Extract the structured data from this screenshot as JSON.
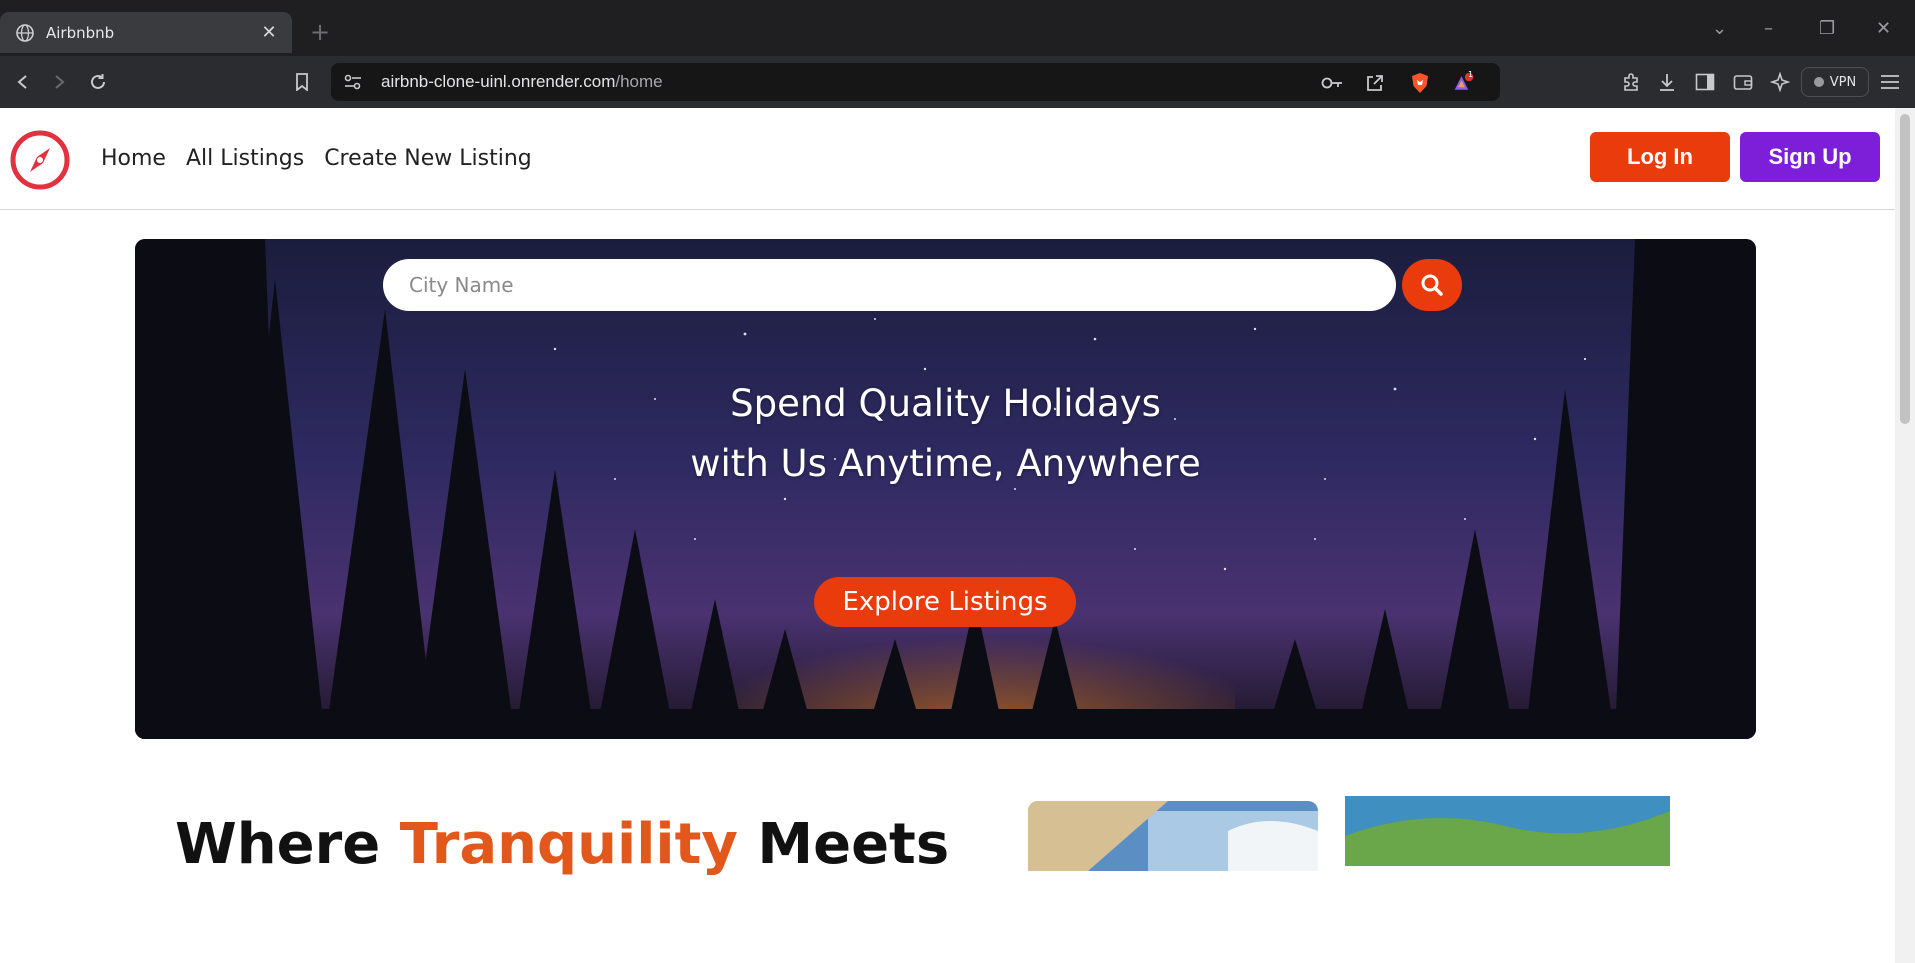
{
  "browser": {
    "tab_title": "Airbnbnb",
    "url_domain": "airbnb-clone-uinl.onrender.com",
    "url_path": "/home",
    "vpn_label": "VPN",
    "notification_count": "1"
  },
  "navbar": {
    "links": [
      "Home",
      "All Listings",
      "Create New Listing"
    ],
    "login_label": "Log In",
    "signup_label": "Sign Up"
  },
  "hero": {
    "search_placeholder": "City Name",
    "headline_line1": "Spend Quality Holidays",
    "headline_line2": "with Us Anytime, Anywhere",
    "cta_label": "Explore Listings"
  },
  "section": {
    "tagline_start": "Where ",
    "tagline_accent": "Tranquility",
    "tagline_end": " Meets"
  },
  "colors": {
    "primary": "#ea3b0c",
    "signup": "#7d1fd8",
    "logo": "#e0333f"
  }
}
